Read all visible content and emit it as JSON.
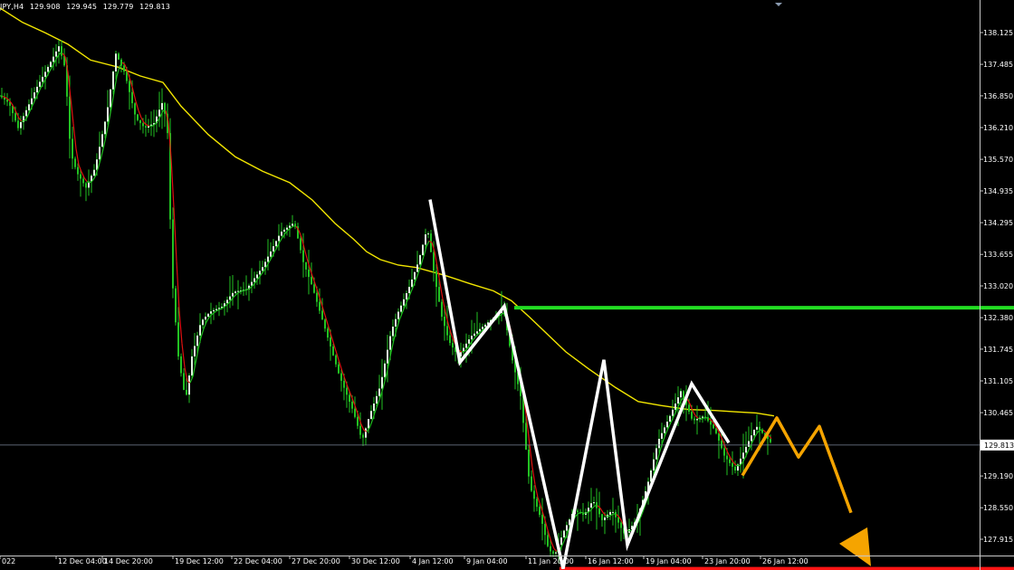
{
  "header": {
    "symbol": "JPY,H4",
    "open": "129.908",
    "high": "129.945",
    "low": "129.779",
    "close": "129.813"
  },
  "current_price_label": "129.813",
  "colors": {
    "background": "#000000",
    "candle": "#22c222",
    "moving_average": "#f2e600",
    "fast_line_up": "#1fbf1f",
    "fast_line_down": "#e01010",
    "resistance_line": "#22dd22",
    "support_line": "#ff1414",
    "zigzag": "#ffffff",
    "projection": "#f5a400",
    "price_line": "#7a8597"
  },
  "chart_data": {
    "type": "line",
    "timeframe": "H4",
    "ylim": [
      127.28,
      138.46
    ],
    "y_ticks": [
      "138.125",
      "137.485",
      "136.850",
      "136.210",
      "135.570",
      "134.935",
      "134.295",
      "133.655",
      "133.020",
      "132.380",
      "131.745",
      "131.105",
      "130.465",
      "129.813",
      "129.190",
      "128.550",
      "127.915"
    ],
    "x_ticks": [
      "022",
      "12 Dec 04:00",
      "14 Dec 20:00",
      "19 Dec 12:00",
      "22 Dec 04:00",
      "27 Dec 20:00",
      "30 Dec 12:00",
      "4 Jan 12:00",
      "9 Jan 04:00",
      "11 Jan 20:00",
      "16 Jan 12:00",
      "19 Jan 04:00",
      "23 Jan 20:00",
      "26 Jan 12:00"
    ],
    "current_price": 129.813,
    "resistance_level": 132.58,
    "support_level": 127.32,
    "price_path": [
      [
        0,
        136.85
      ],
      [
        10,
        136.7
      ],
      [
        20,
        136.2
      ],
      [
        30,
        136.6
      ],
      [
        40,
        137.0
      ],
      [
        55,
        137.5
      ],
      [
        65,
        137.85
      ],
      [
        72,
        137.4
      ],
      [
        78,
        135.7
      ],
      [
        85,
        135.3
      ],
      [
        95,
        135.0
      ],
      [
        105,
        135.4
      ],
      [
        118,
        136.5
      ],
      [
        128,
        137.7
      ],
      [
        138,
        137.3
      ],
      [
        150,
        136.4
      ],
      [
        160,
        136.2
      ],
      [
        170,
        136.3
      ],
      [
        180,
        136.75
      ],
      [
        185,
        136.1
      ],
      [
        190,
        133.2
      ],
      [
        197,
        131.6
      ],
      [
        205,
        130.7
      ],
      [
        212,
        131.6
      ],
      [
        222,
        132.3
      ],
      [
        232,
        132.5
      ],
      [
        245,
        132.6
      ],
      [
        258,
        132.9
      ],
      [
        272,
        132.95
      ],
      [
        290,
        133.4
      ],
      [
        310,
        134.1
      ],
      [
        325,
        134.3
      ],
      [
        335,
        133.5
      ],
      [
        345,
        133.0
      ],
      [
        360,
        132.1
      ],
      [
        375,
        131.2
      ],
      [
        390,
        130.5
      ],
      [
        400,
        129.9
      ],
      [
        408,
        130.4
      ],
      [
        420,
        131.0
      ],
      [
        432,
        132.1
      ],
      [
        440,
        132.5
      ],
      [
        452,
        133.0
      ],
      [
        462,
        133.5
      ],
      [
        472,
        134.2
      ],
      [
        480,
        133.2
      ],
      [
        488,
        132.4
      ],
      [
        496,
        131.9
      ],
      [
        506,
        131.6
      ],
      [
        520,
        132.0
      ],
      [
        540,
        132.3
      ],
      [
        556,
        132.55
      ],
      [
        565,
        131.6
      ],
      [
        575,
        130.8
      ],
      [
        585,
        129.0
      ],
      [
        598,
        128.3
      ],
      [
        606,
        127.7
      ],
      [
        613,
        127.6
      ],
      [
        622,
        128.05
      ],
      [
        634,
        128.5
      ],
      [
        645,
        128.4
      ],
      [
        655,
        128.7
      ],
      [
        665,
        128.3
      ],
      [
        676,
        128.5
      ],
      [
        690,
        128.0
      ],
      [
        703,
        128.3
      ],
      [
        715,
        129.0
      ],
      [
        727,
        129.9
      ],
      [
        740,
        130.4
      ],
      [
        752,
        130.9
      ],
      [
        765,
        130.3
      ],
      [
        778,
        130.4
      ],
      [
        790,
        130.1
      ],
      [
        800,
        129.6
      ],
      [
        812,
        129.3
      ],
      [
        822,
        129.7
      ],
      [
        835,
        130.2
      ],
      [
        845,
        130.0
      ],
      [
        852,
        129.85
      ]
    ],
    "moving_average": [
      [
        0,
        138.62
      ],
      [
        25,
        138.33
      ],
      [
        50,
        138.12
      ],
      [
        75,
        137.89
      ],
      [
        100,
        137.57
      ],
      [
        130,
        137.43
      ],
      [
        155,
        137.25
      ],
      [
        180,
        137.12
      ],
      [
        200,
        136.64
      ],
      [
        230,
        136.07
      ],
      [
        260,
        135.62
      ],
      [
        290,
        135.33
      ],
      [
        320,
        135.1
      ],
      [
        345,
        134.75
      ],
      [
        370,
        134.28
      ],
      [
        390,
        133.97
      ],
      [
        405,
        133.71
      ],
      [
        420,
        133.55
      ],
      [
        440,
        133.44
      ],
      [
        460,
        133.39
      ],
      [
        490,
        133.24
      ],
      [
        520,
        133.06
      ],
      [
        545,
        132.92
      ],
      [
        565,
        132.72
      ],
      [
        585,
        132.39
      ],
      [
        605,
        132.04
      ],
      [
        625,
        131.69
      ],
      [
        650,
        131.35
      ],
      [
        680,
        130.97
      ],
      [
        705,
        130.69
      ],
      [
        730,
        130.61
      ],
      [
        760,
        130.53
      ],
      [
        790,
        130.51
      ],
      [
        815,
        130.48
      ],
      [
        835,
        130.46
      ],
      [
        855,
        130.4
      ]
    ],
    "zigzag": [
      [
        475,
        134.76
      ],
      [
        508,
        131.48
      ],
      [
        557,
        132.61
      ],
      [
        622,
        127.32
      ],
      [
        667,
        131.53
      ],
      [
        693,
        127.8
      ],
      [
        764,
        131.05
      ],
      [
        805,
        129.86
      ]
    ],
    "projection": [
      [
        820,
        129.2
      ],
      [
        858,
        130.36
      ],
      [
        882,
        129.57
      ],
      [
        905,
        130.19
      ],
      [
        948,
        128.1
      ]
    ]
  }
}
